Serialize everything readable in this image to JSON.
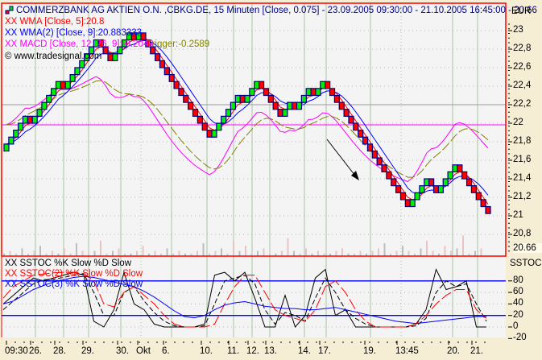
{
  "header": {
    "title": "COMMERZBANK AG AKTIEN O.N. ,CBKG.DE, 15 Minuten [Close, 0.075] - 23.09.2005 09:30:00 - 21.10.2005 16:45:00 - 20.66",
    "legend": [
      {
        "text": "XX WMA [Close, 5]:20.8",
        "color": "#ff0000"
      },
      {
        "text": "XX WMA(2) [Close, 9]:20.883333",
        "color": "#0000ff"
      },
      {
        "text": "XX MACD [Close, 12, 26, 9]:-0.2049",
        "color": "#ff00ff"
      },
      {
        "text": "Trigger:-0.2589",
        "color": "#808000"
      }
    ],
    "copyright": "© www.tradesignal.com"
  },
  "colors": {
    "up": "#00ee00",
    "down": "#ff0000",
    "border": "#000080",
    "wma5": "#ff0000",
    "wma9": "#0000ff",
    "macd": "#ff00ff",
    "trigger": "#808000",
    "frame": "#ff0000"
  },
  "chart_data": [
    {
      "type": "renko",
      "title": "COMMERZBANK AG AKTIEN O.N. ,CBKG.DE, 15 Minuten",
      "unit_label": "EUR",
      "brick_size": 0.075,
      "start": 21.7,
      "moves": [
        5,
        -1,
        6,
        -1,
        7,
        -3,
        4,
        -1,
        1,
        -15,
        6,
        -1,
        3,
        -5,
        2,
        -1,
        3,
        -1,
        2,
        -18,
        4,
        -2,
        4,
        -7
      ],
      "last_value": "20.66",
      "ylim": [
        20.66,
        23.1
      ],
      "yticks": [
        "23",
        "22,8",
        "22,6",
        "22,4",
        "22,2",
        "22",
        "21,8",
        "21,6",
        "21,4",
        "21,2",
        "21",
        "20,8"
      ],
      "ytick_values": [
        23,
        22.8,
        22.6,
        22.4,
        22.2,
        22,
        21.8,
        21.6,
        21.4,
        21.2,
        21,
        20.8
      ],
      "volume": [
        1,
        2,
        1,
        3,
        1,
        2,
        4,
        1,
        2,
        1,
        3,
        1,
        5,
        2,
        1,
        2,
        6,
        1,
        2,
        3,
        1,
        1,
        2,
        4,
        1,
        2,
        1,
        3,
        1,
        2,
        1,
        1,
        2,
        5,
        1,
        2,
        3,
        1,
        6,
        2,
        4,
        1,
        2,
        3,
        1,
        1,
        2,
        7,
        2,
        1,
        3,
        1,
        2,
        1,
        1,
        2,
        3,
        1,
        1,
        2,
        1,
        2,
        3,
        5,
        1,
        2,
        4,
        2,
        1,
        3,
        6,
        2,
        1,
        4,
        2,
        3,
        8,
        1,
        2,
        3
      ],
      "xticks": [
        "09:30",
        "26.",
        "28.",
        "29.",
        "30.",
        "Okt",
        "6.",
        "10.",
        "11.",
        "12.",
        "13.",
        "14.",
        "17.",
        "19.",
        "13:45",
        "20.",
        "21."
      ]
    },
    {
      "type": "line",
      "title": "XX SSTOC %K Slow %D Slow",
      "legend": [
        "XX SSTOC %K Slow %D Slow",
        "XX SSTOC(2) %K Slow %D Slow",
        "XX SSTOC(3) %K Slow %D Slow"
      ],
      "unit_label": "SSTOC",
      "yticks": [
        "80",
        "60",
        "40",
        "20",
        "0",
        "-20"
      ],
      "ytick_values": [
        80,
        60,
        40,
        20,
        0,
        -20
      ],
      "hlines": [
        80,
        20
      ],
      "series": [
        {
          "name": "SSTOC %K",
          "color": "#000000",
          "values": [
            40,
            55,
            70,
            85,
            80,
            85,
            90,
            95,
            90,
            10,
            0,
            30,
            95,
            40,
            30,
            5,
            0,
            0,
            0,
            0,
            5,
            90,
            95,
            80,
            95,
            50,
            0,
            0,
            55,
            0,
            20,
            85,
            100,
            20,
            30,
            0,
            0,
            0,
            0,
            0,
            0,
            5,
            30,
            100,
            65,
            70,
            80,
            0,
            0
          ]
        },
        {
          "name": "SSTOC %D",
          "color": "#000000",
          "values": [
            30,
            45,
            60,
            75,
            82,
            83,
            86,
            90,
            92,
            60,
            20,
            20,
            60,
            70,
            45,
            25,
            10,
            2,
            0,
            0,
            2,
            40,
            80,
            85,
            90,
            75,
            30,
            5,
            25,
            20,
            10,
            50,
            85,
            60,
            30,
            15,
            5,
            0,
            0,
            0,
            0,
            2,
            15,
            60,
            80,
            70,
            75,
            40,
            10
          ]
        },
        {
          "name": "SSTOC(2) %K",
          "color": "#ff0000",
          "values": [
            50,
            70,
            80,
            90,
            92,
            94,
            95,
            95,
            93,
            80,
            40,
            35,
            60,
            70,
            55,
            40,
            20,
            5,
            0,
            0,
            0,
            5,
            40,
            70,
            90,
            90,
            60,
            30,
            20,
            15,
            10,
            30,
            70,
            80,
            60,
            30,
            10,
            0,
            0,
            0,
            0,
            5,
            20,
            40,
            55,
            65,
            65,
            30,
            15
          ]
        },
        {
          "name": "SSTOC(3) %K",
          "color": "#0000ff",
          "values": [
            40,
            45,
            55,
            65,
            72,
            78,
            82,
            86,
            88,
            86,
            82,
            78,
            74,
            70,
            62,
            52,
            40,
            28,
            18,
            16,
            20,
            30,
            38,
            42,
            44,
            40,
            36,
            34,
            32,
            32,
            30,
            30,
            32,
            34,
            30,
            26,
            22,
            18,
            14,
            10,
            8,
            6,
            8,
            10,
            12,
            14,
            16,
            18,
            18
          ]
        }
      ]
    }
  ]
}
